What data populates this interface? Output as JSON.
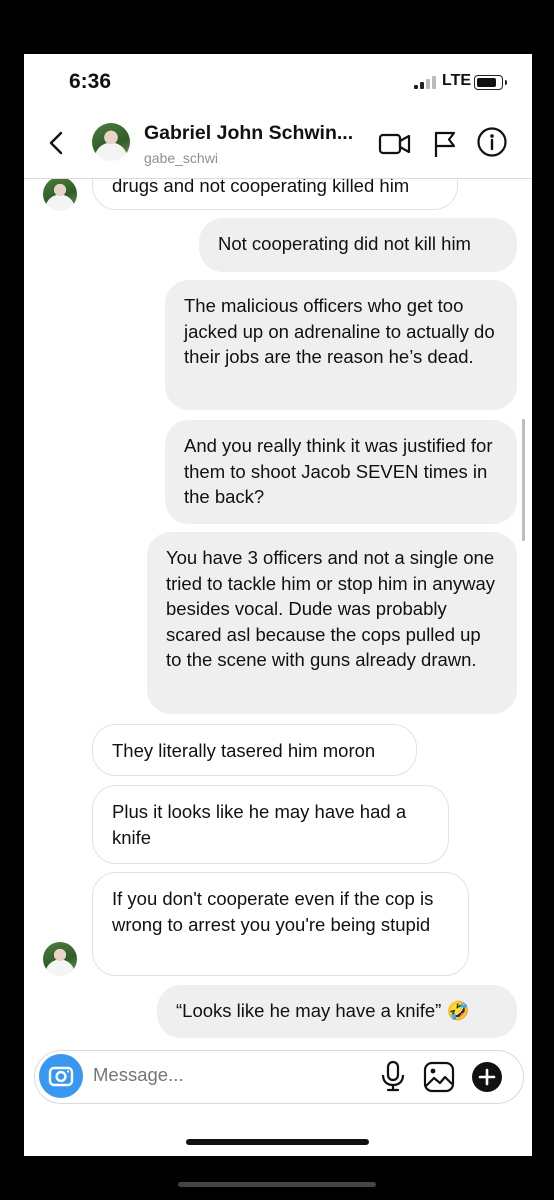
{
  "status_bar": {
    "time": "6:36",
    "network": "LTE"
  },
  "header": {
    "name": "Gabriel John Schwin...",
    "username": "gabe_schwi"
  },
  "messages": [
    {
      "from": "them",
      "text": "drugs and not cooperating killed him"
    },
    {
      "from": "me",
      "text": "Not cooperating did not kill him"
    },
    {
      "from": "me",
      "text": "The malicious officers who get too jacked up on adrenaline to actually do their jobs are the reason he’s dead."
    },
    {
      "from": "me",
      "text": "And you really think it was justified for them to shoot Jacob SEVEN times in the back?"
    },
    {
      "from": "me",
      "text": "You have 3 officers and not a single one tried to tackle him or stop him in anyway besides vocal. Dude was probably scared asl because the cops pulled up to the scene with guns already drawn."
    },
    {
      "from": "them",
      "text": "They literally tasered him moron"
    },
    {
      "from": "them",
      "text": "Plus it looks like he may have had a knife"
    },
    {
      "from": "them",
      "text": "If you don't cooperate even if the cop is wrong to arrest you you're being stupid"
    },
    {
      "from": "me",
      "text": "“Looks like he may have a knife”",
      "emoji": "🤣"
    }
  ],
  "composer": {
    "placeholder": "Message..."
  },
  "icons": {
    "back": "chevron-left-icon",
    "video": "video-camera-icon",
    "report": "flag-icon",
    "info": "info-icon",
    "camera": "camera-icon",
    "mic": "microphone-icon",
    "gallery": "image-icon",
    "more": "plus-circle-icon"
  },
  "colors": {
    "camera_button": "#3897f0",
    "outgoing_bubble": "#efefef",
    "incoming_border": "#e2e2e2"
  }
}
